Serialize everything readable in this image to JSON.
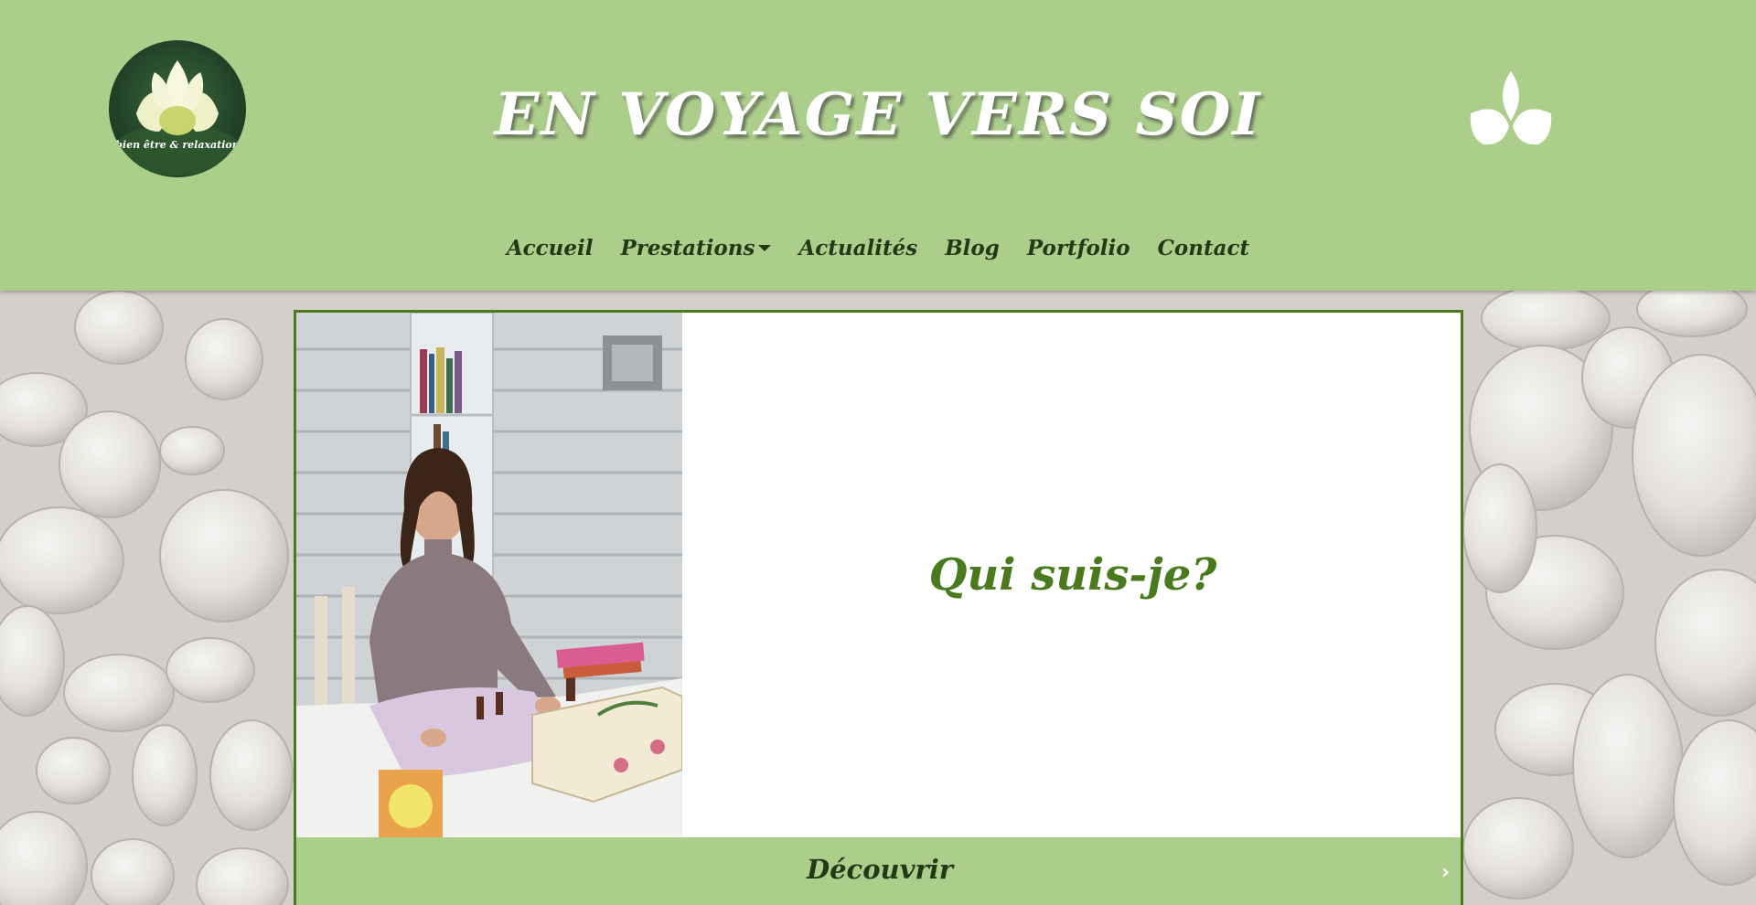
{
  "site": {
    "title": "EN VOYAGE VERS SOI",
    "logo_text": "bien être & relaxation"
  },
  "nav": {
    "items": [
      {
        "label": "Accueil",
        "has_dropdown": false
      },
      {
        "label": "Prestations",
        "has_dropdown": true
      },
      {
        "label": "Actualités",
        "has_dropdown": false
      },
      {
        "label": "Blog",
        "has_dropdown": false
      },
      {
        "label": "Portfolio",
        "has_dropdown": false
      },
      {
        "label": "Contact",
        "has_dropdown": false
      }
    ]
  },
  "card": {
    "heading": "Qui suis-je?",
    "link_label": "Découvrir",
    "link_icon": "chevron-right-icon"
  },
  "colors": {
    "header_bg": "#acce8b",
    "nav_text": "#1f3a14",
    "accent_green": "#4a7a1e",
    "title_text": "#ffffff"
  },
  "icons": [
    "lotus-logo",
    "leaf-icon",
    "caret-down-icon",
    "chevron-right-icon"
  ]
}
